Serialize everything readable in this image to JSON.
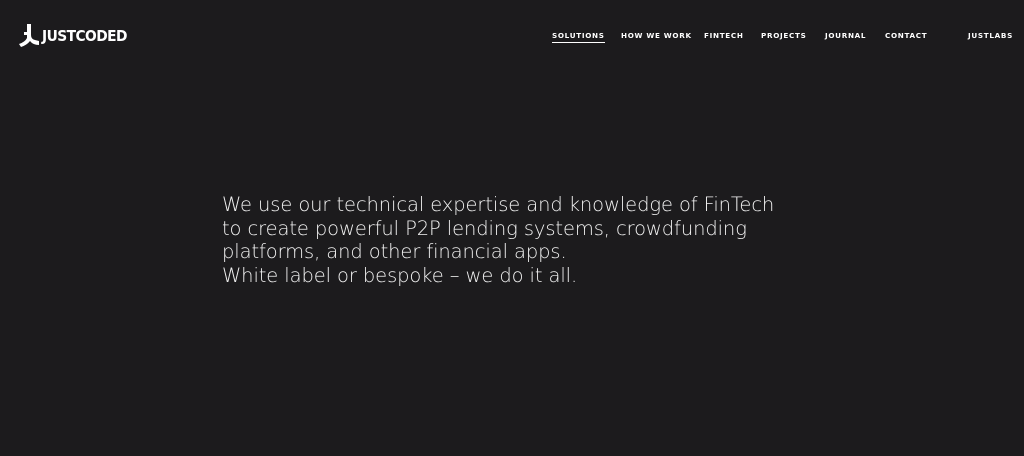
{
  "brand": {
    "name": "JUSTCODED",
    "logo_icon": "justcoded-logo-icon"
  },
  "nav": {
    "items": [
      {
        "label": "SOLUTIONS",
        "active": true
      },
      {
        "label": "HOW WE WORK",
        "active": false
      },
      {
        "label": "FINTECH",
        "active": false
      },
      {
        "label": "PROJECTS",
        "active": false
      },
      {
        "label": "JOURNAL",
        "active": false
      },
      {
        "label": "CONTACT",
        "active": false
      },
      {
        "label": "JUSTLABS",
        "active": false
      }
    ]
  },
  "hero": {
    "line1": "We use our technical expertise and knowledge of FinTech",
    "line2": "to create powerful P2P lending systems, crowdfunding",
    "line3": "platforms, and other financial apps.",
    "line4": "White label or bespoke – we do it all."
  },
  "colors": {
    "background": "#1c1b1d",
    "text": "#ffffff"
  }
}
